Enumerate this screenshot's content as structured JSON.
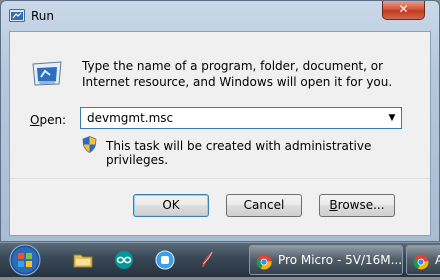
{
  "window": {
    "title": "Run",
    "close_glyph": "✕"
  },
  "dialog": {
    "description": "Type the name of a program, folder, document, or Internet resource, and Windows will open it for you.",
    "open_label": "Open:",
    "open_label_underline": "O",
    "open_label_rest": "pen:",
    "open_value": "devmgmt.msc",
    "admin_note": "This task will be created with administrative privileges.",
    "buttons": {
      "ok": "OK",
      "cancel": "Cancel",
      "browse": "Browse...",
      "browse_underline": "B",
      "browse_rest": "rowse..."
    }
  },
  "taskbar": {
    "icons": [
      "start-orb",
      "folder-icon",
      "arduino-icon",
      "app-icon",
      "feather-icon"
    ],
    "items": [
      {
        "label": "Pro Micro - 5V/16M..."
      },
      {
        "label": "A"
      }
    ]
  }
}
